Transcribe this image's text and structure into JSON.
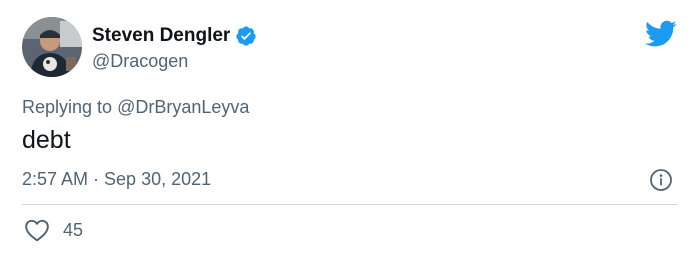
{
  "tweet": {
    "author_name": "Steven Dengler",
    "handle": "@Dracogen",
    "verified": true,
    "reply_prefix": "Replying to",
    "reply_to": "@DrBryanLeyva",
    "text": "debt",
    "timestamp": "2:57 AM · Sep 30, 2021",
    "likes": "45"
  },
  "icons": {
    "logo": "twitter-bird-icon",
    "verified": "verified-badge-icon",
    "info": "info-icon",
    "like": "heart-icon"
  },
  "colors": {
    "brand": "#1d9bf0",
    "text_primary": "#0f1419",
    "text_secondary": "#536471",
    "divider": "#cfd9de"
  }
}
